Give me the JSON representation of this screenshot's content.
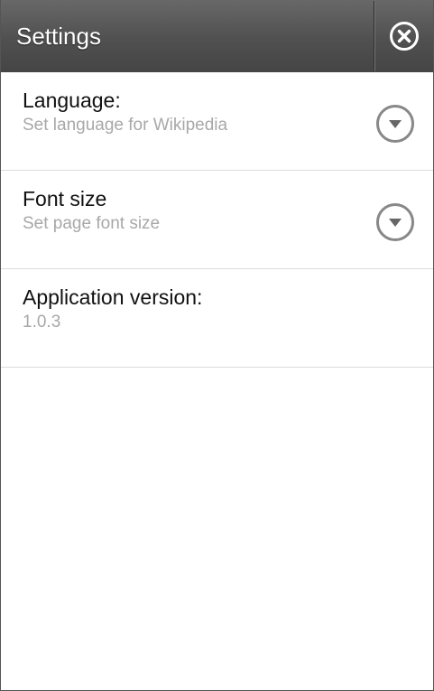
{
  "header": {
    "title": "Settings",
    "close_icon": "close-circle-icon"
  },
  "settings": {
    "language": {
      "title": "Language:",
      "subtitle": "Set language for Wikipedia",
      "icon": "chevron-down-circle-icon"
    },
    "font_size": {
      "title": "Font size",
      "subtitle": "Set page font size",
      "icon": "chevron-down-circle-icon"
    },
    "app_version": {
      "title": "Application version:",
      "value": "1.0.3"
    }
  },
  "colors": {
    "header_bg": "#505050",
    "title_text": "#111111",
    "subtitle_text": "#a8a8a8",
    "divider": "#dcdcdc"
  }
}
